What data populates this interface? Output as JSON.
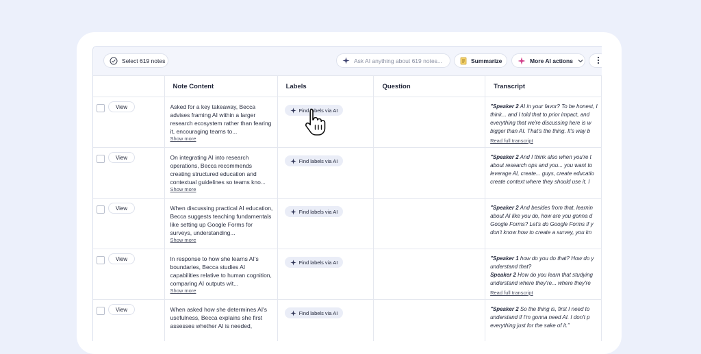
{
  "toolbar": {
    "select_label": "Select 619 notes",
    "ask_placeholder": "Ask AI anything about 619 notes...",
    "summarize_label": "Summarize",
    "more_ai_label": "More AI actions"
  },
  "columns": {
    "note_content": "Note Content",
    "labels": "Labels",
    "question": "Question",
    "transcript": "Transcript"
  },
  "rows": [
    {
      "view": "View",
      "note": "Asked for a key takeaway, Becca advises framing AI within a larger research ecosystem rather than fearing it, encouraging teams to...",
      "show_more": "Show more",
      "label_button": "Find labels via AI",
      "transcript": [
        {
          "speaker": "\"Speaker 2",
          "text": " AI in your favor? To be honest, I"
        },
        {
          "speaker": "",
          "text": "think... and I told that to prior impact, and"
        },
        {
          "speaker": "",
          "text": "everything that we're discussing here is w"
        },
        {
          "speaker": "",
          "text": "bigger than AI. That's the thing. It's way b"
        }
      ],
      "read_full": "Read full transcript"
    },
    {
      "view": "View",
      "note": "On integrating AI into research operations, Becca recommends creating structured education and contextual guidelines so teams kno...",
      "show_more": "Show more",
      "label_button": "Find labels via AI",
      "transcript": [
        {
          "speaker": "\"Speaker 2",
          "text": " And I think also when you're t"
        },
        {
          "speaker": "",
          "text": "about research ops and you... you want to"
        },
        {
          "speaker": "",
          "text": "leverage AI, create... guys, create educatio"
        },
        {
          "speaker": "",
          "text": "create context where they should use it. I"
        }
      ],
      "read_full": ""
    },
    {
      "view": "View",
      "note": "When discussing practical AI education, Becca suggests teaching fundamentals like setting up Google Forms for surveys, understanding...",
      "show_more": "Show more",
      "label_button": "Find labels via AI",
      "transcript": [
        {
          "speaker": "\"Speaker 2",
          "text": " And besides from that, learnin"
        },
        {
          "speaker": "",
          "text": "about AI like you do, how are you gonna d"
        },
        {
          "speaker": "",
          "text": "Google Forms? Let's do Google Forms if y"
        },
        {
          "speaker": "",
          "text": "don't know how to create a survey, you kn"
        }
      ],
      "read_full": ""
    },
    {
      "view": "View",
      "note": "In response to how she learns AI's boundaries, Becca studies AI capabilities relative to human cognition, comparing AI outputs wit...",
      "show_more": "Show more",
      "label_button": "Find labels via AI",
      "transcript": [
        {
          "speaker": "\"Speaker 1",
          "text": " how do you do that? How do y"
        },
        {
          "speaker": "",
          "text": "understand that?"
        },
        {
          "speaker": "Speaker 2",
          "text": " How do you learn that studying"
        },
        {
          "speaker": "",
          "text": "understand where they're... where they're"
        }
      ],
      "read_full": "Read full transcript"
    },
    {
      "view": "View",
      "note": "When asked how she determines AI's usefulness, Becca explains she first assesses whether AI is needed,",
      "show_more": "",
      "label_button": "Find labels via AI",
      "transcript": [
        {
          "speaker": "\"Speaker 2",
          "text": " So the thing is, first I need to"
        },
        {
          "speaker": "",
          "text": "understand if I'm gonna need AI. I don't p"
        },
        {
          "speaker": "",
          "text": "everything just for the sake of it.\""
        }
      ],
      "read_full": ""
    }
  ],
  "colors": {
    "background": "#ecf0fb",
    "toolbar": "#f3f5fc",
    "label_button": "#eaedf7",
    "accent": "#5b4bd6"
  }
}
